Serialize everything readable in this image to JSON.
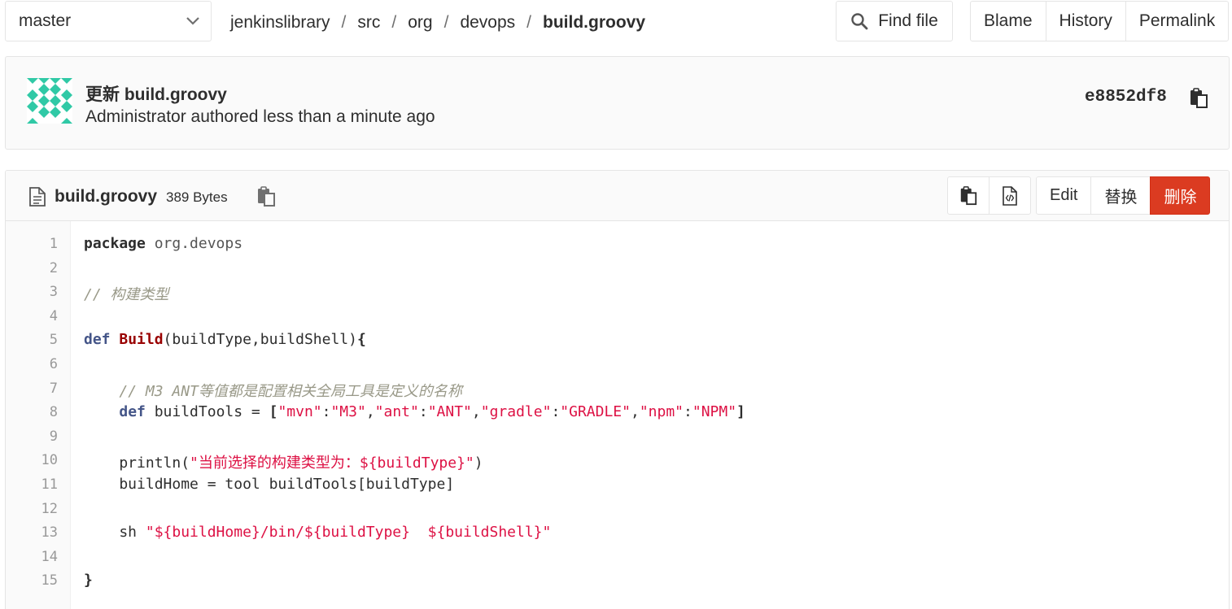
{
  "nav": {
    "branch": "master",
    "breadcrumb": [
      "jenkinslibrary",
      "src",
      "org",
      "devops",
      "build.groovy"
    ],
    "breadcrumb_sep": "/",
    "find_file_label": "Find file",
    "view_buttons": [
      "Blame",
      "History",
      "Permalink"
    ]
  },
  "commit": {
    "title": "更新 build.groovy",
    "meta": "Administrator authored less than a minute ago",
    "sha": "e8852df8"
  },
  "file": {
    "name": "build.groovy",
    "size": "389 Bytes",
    "actions": {
      "edit": "Edit",
      "replace": "替换",
      "delete": "删除"
    }
  },
  "code": {
    "line_numbers": [
      "1",
      "2",
      "3",
      "4",
      "5",
      "6",
      "7",
      "8",
      "9",
      "10",
      "11",
      "12",
      "13",
      "14",
      "15"
    ],
    "lines": [
      [
        [
          "kw",
          "package"
        ],
        [
          "plain",
          " "
        ],
        [
          "name",
          "org.devops"
        ]
      ],
      [],
      [
        [
          "com",
          "// 构建类型"
        ]
      ],
      [],
      [
        [
          "def",
          "def"
        ],
        [
          "plain",
          " "
        ],
        [
          "fn",
          "Build"
        ],
        [
          "plain",
          "(buildType,buildShell)"
        ],
        [
          "pun",
          "{"
        ]
      ],
      [],
      [
        [
          "plain",
          "    "
        ],
        [
          "com",
          "// M3 ANT等值都是配置相关全局工具是定义的名称"
        ]
      ],
      [
        [
          "plain",
          "    "
        ],
        [
          "def",
          "def"
        ],
        [
          "plain",
          " buildTools = "
        ],
        [
          "pun",
          "["
        ],
        [
          "str",
          "\"mvn\""
        ],
        [
          "plain",
          ":"
        ],
        [
          "str",
          "\"M3\""
        ],
        [
          "plain",
          ","
        ],
        [
          "str",
          "\"ant\""
        ],
        [
          "plain",
          ":"
        ],
        [
          "str",
          "\"ANT\""
        ],
        [
          "plain",
          ","
        ],
        [
          "str",
          "\"gradle\""
        ],
        [
          "plain",
          ":"
        ],
        [
          "str",
          "\"GRADLE\""
        ],
        [
          "plain",
          ","
        ],
        [
          "str",
          "\"npm\""
        ],
        [
          "plain",
          ":"
        ],
        [
          "str",
          "\"NPM\""
        ],
        [
          "pun",
          "]"
        ]
      ],
      [],
      [
        [
          "plain",
          "    println("
        ],
        [
          "str",
          "\"当前选择的构建类型为：${buildType}\""
        ],
        [
          "plain",
          ")"
        ]
      ],
      [
        [
          "plain",
          "    buildHome = tool buildTools[buildType]"
        ]
      ],
      [],
      [
        [
          "plain",
          "    sh "
        ],
        [
          "str",
          "\"${buildHome}/bin/${buildType}  ${buildShell}\""
        ]
      ],
      [],
      [
        [
          "pun",
          "}"
        ]
      ]
    ]
  },
  "colors": {
    "danger": "#db3b21",
    "avatar": "#30c9a6"
  }
}
